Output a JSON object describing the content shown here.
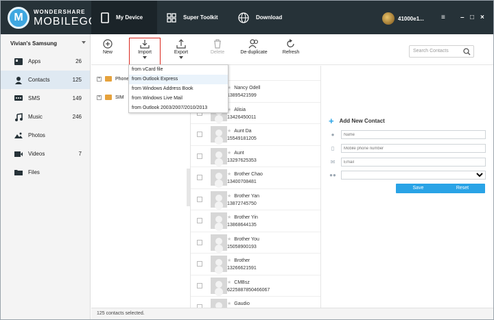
{
  "header": {
    "logo_brand": "WONDERSHARE",
    "logo_product": "MOBILEGO",
    "logo_mark": "M",
    "tabs": [
      {
        "label": "My Device"
      },
      {
        "label": "Super Toolkit"
      },
      {
        "label": "Download"
      }
    ],
    "account": "41000e1...",
    "menu_icon": "≡",
    "minimize": "–",
    "maximize": "□",
    "close": "×"
  },
  "sidebar": {
    "device": "Vivian's Samsung",
    "items": [
      {
        "label": "Apps",
        "count": "26",
        "icon": "apps-icon"
      },
      {
        "label": "Contacts",
        "count": "125",
        "icon": "contacts-icon"
      },
      {
        "label": "SMS",
        "count": "149",
        "icon": "sms-icon"
      },
      {
        "label": "Music",
        "count": "246",
        "icon": "music-icon"
      },
      {
        "label": "Photos",
        "count": "",
        "icon": "photos-icon"
      },
      {
        "label": "Videos",
        "count": "7",
        "icon": "videos-icon"
      },
      {
        "label": "Files",
        "count": "",
        "icon": "files-icon"
      }
    ]
  },
  "toolbar": {
    "new": "New",
    "import": "Import",
    "export": "Export",
    "delete": "Delete",
    "deduplicate": "De-duplicate",
    "refresh": "Refresh",
    "search_placeholder": "Search Contacts"
  },
  "import_menu": [
    "from vCard file",
    "from Outlook Express",
    "from Windows Address Book",
    "from Windows Live Mail",
    "from Outlook 2003/2007/2010/2013"
  ],
  "groups": [
    "Phone",
    "SIM"
  ],
  "contacts": [
    {
      "name": "Nancy  Odell",
      "number": "13895421599"
    },
    {
      "name": "Alisia",
      "number": "13426450011"
    },
    {
      "name": "Aunt Da",
      "number": "15549181205"
    },
    {
      "name": "Aunt",
      "number": "13297625353"
    },
    {
      "name": "Brother Chao",
      "number": "13400708481"
    },
    {
      "name": "Brother Yan",
      "number": "13872745750"
    },
    {
      "name": "Brother Yin",
      "number": "13868644135"
    },
    {
      "name": "Brother You",
      "number": "15058900193"
    },
    {
      "name": "Brother",
      "number": "13266621591"
    },
    {
      "name": "CMBsz",
      "number": "6225887850466067"
    },
    {
      "name": "Gaudio",
      "number": "13980077230"
    }
  ],
  "add_contact": {
    "title": "Add New Contact",
    "name_placeholder": "Name",
    "phone_placeholder": "Mobile phone number",
    "email_placeholder": "Email",
    "save": "Save",
    "reset": "Reset"
  },
  "status": "125 contacts selected.",
  "colors": {
    "header_bg": "#263238",
    "accent": "#29a3e6",
    "import_highlight": "#d9261c"
  }
}
